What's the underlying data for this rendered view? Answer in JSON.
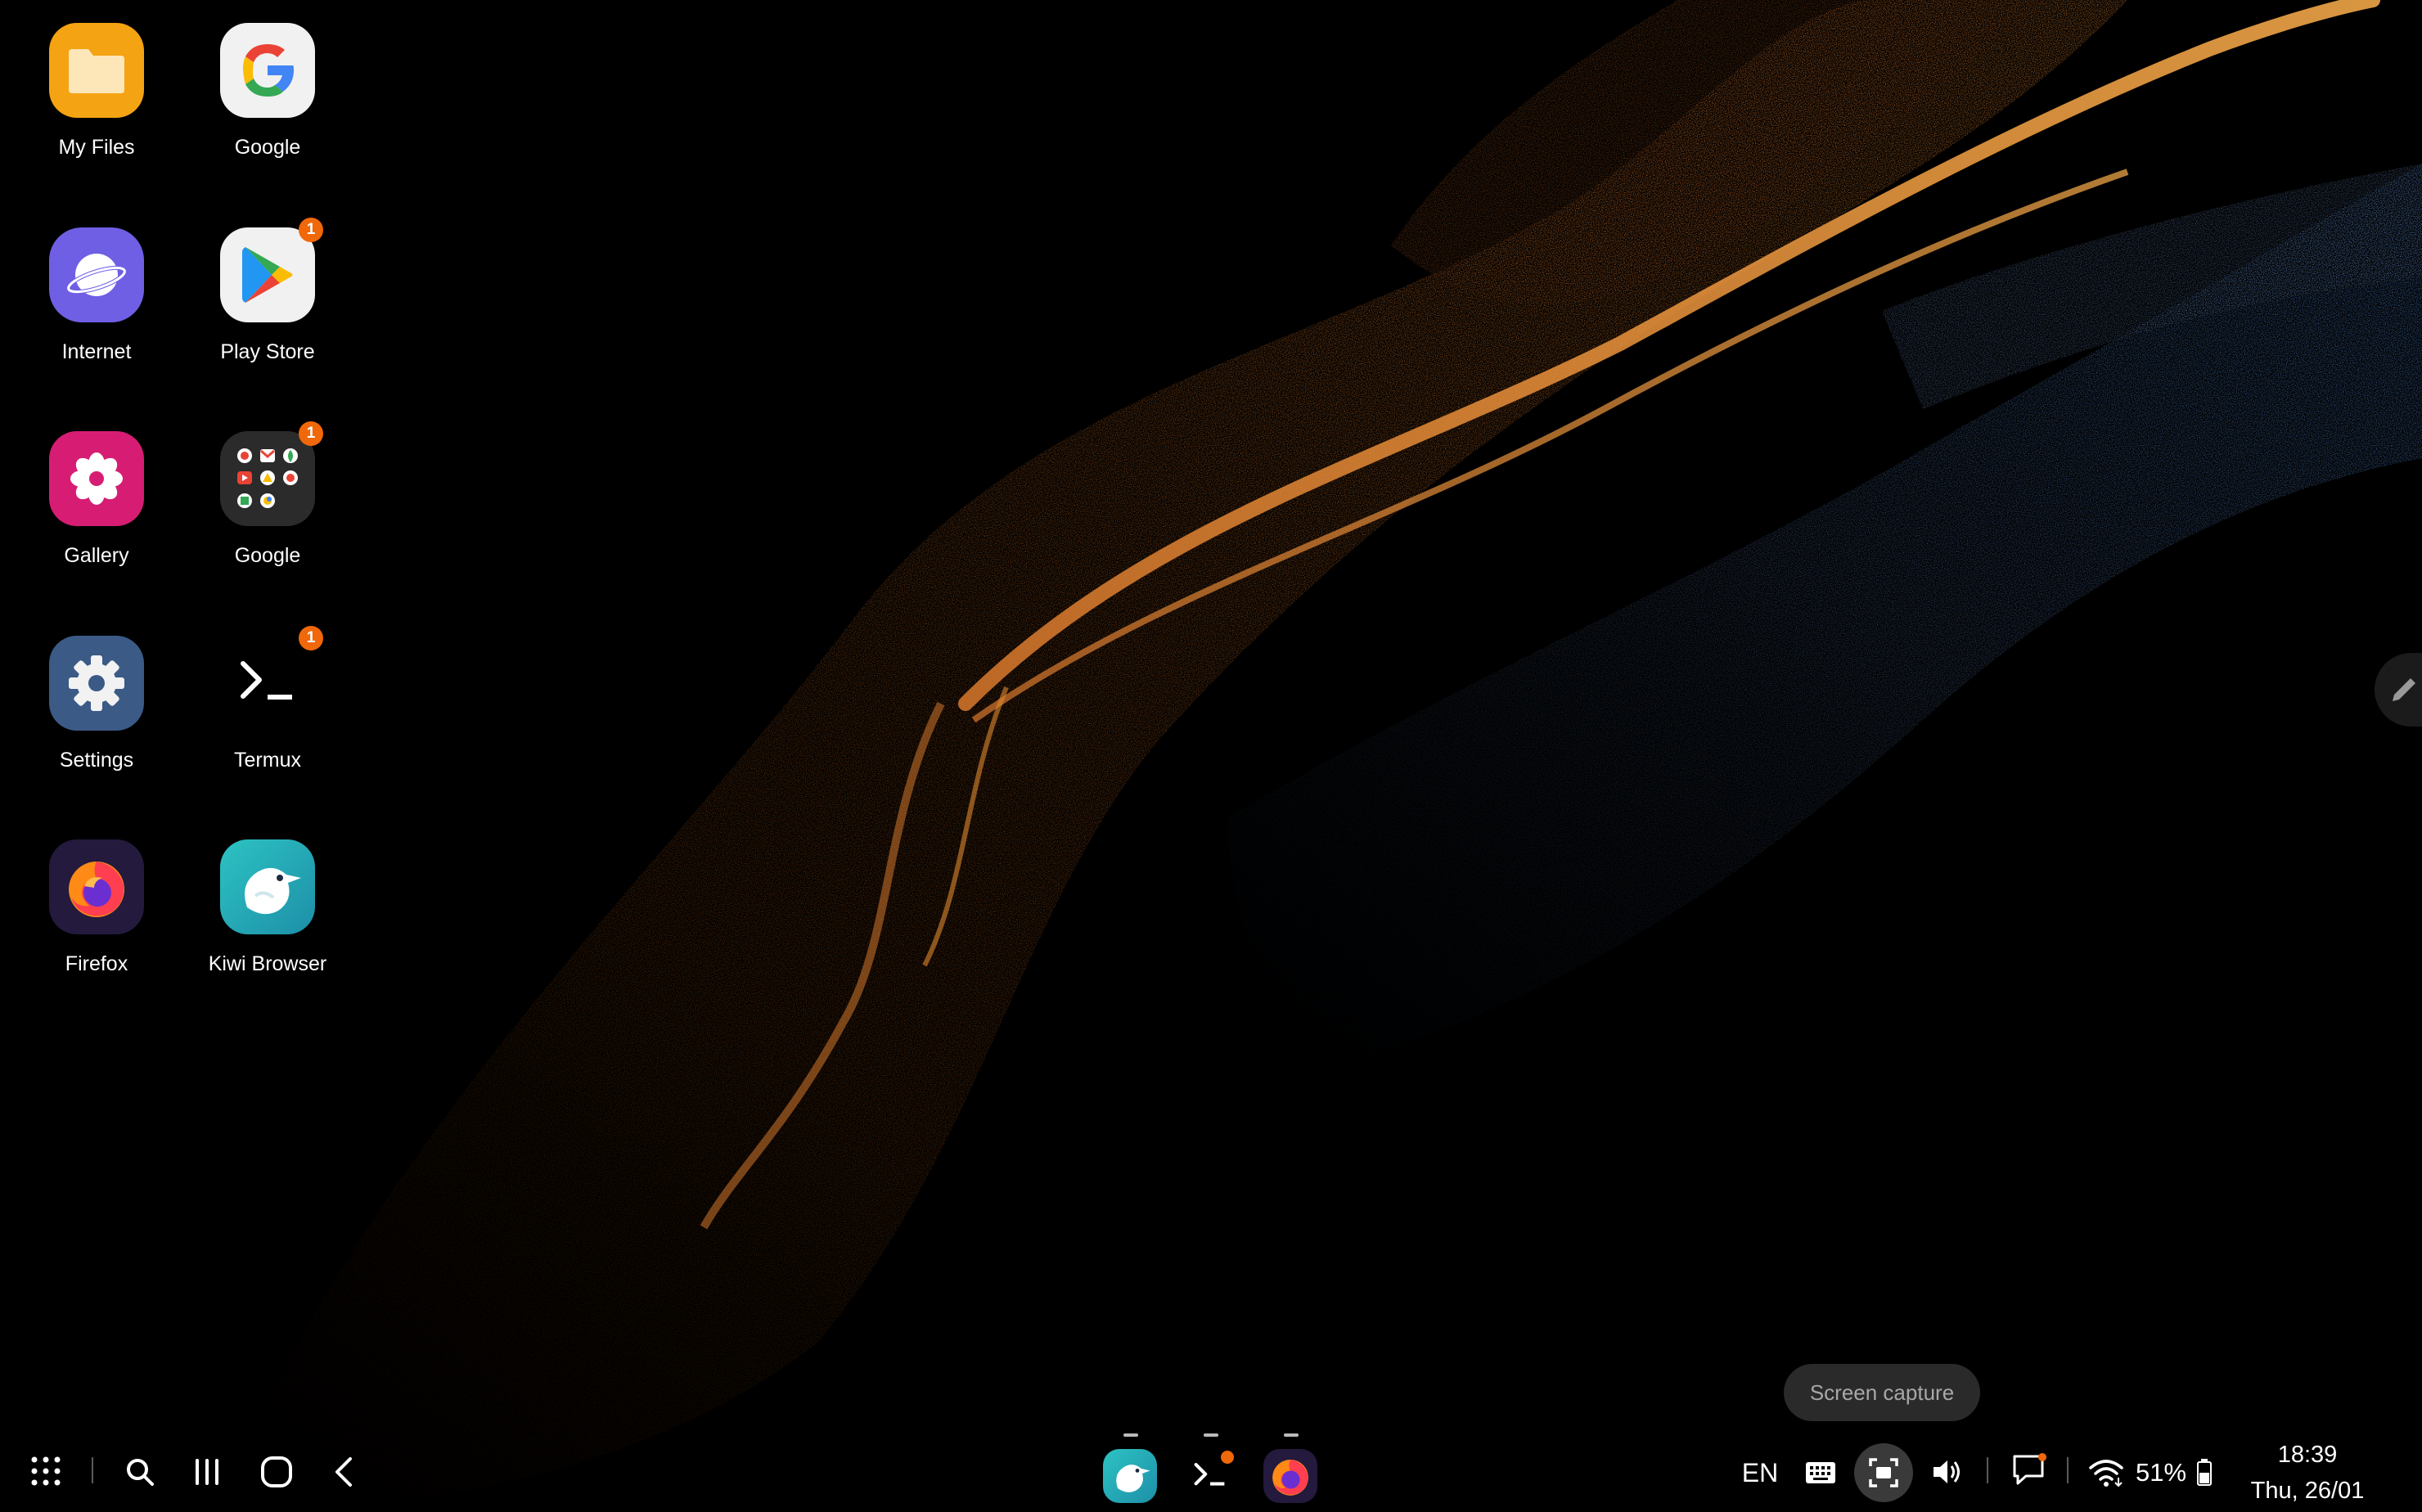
{
  "desktop": {
    "apps": [
      {
        "label": "My Files",
        "icon": "folder-icon"
      },
      {
        "label": "Google",
        "icon": "google-g-icon"
      },
      {
        "label": "Internet",
        "icon": "samsung-internet-icon"
      },
      {
        "label": "Play Store",
        "icon": "play-store-icon",
        "badge": "1"
      },
      {
        "label": "Gallery",
        "icon": "gallery-flower-icon"
      },
      {
        "label": "Google",
        "icon": "google-folder-icon",
        "badge": "1"
      },
      {
        "label": "Settings",
        "icon": "gear-icon"
      },
      {
        "label": "Termux",
        "icon": "terminal-prompt-icon",
        "badge": "1"
      },
      {
        "label": "Firefox",
        "icon": "firefox-icon"
      },
      {
        "label": "Kiwi Browser",
        "icon": "kiwi-bird-icon"
      }
    ]
  },
  "taskbar": {
    "left_buttons": [
      "app-drawer-icon",
      "search-icon",
      "recent-apps-icon",
      "home-icon",
      "back-icon"
    ],
    "pinned_apps": [
      "kiwi-bird-icon",
      "terminal-prompt-icon",
      "firefox-icon"
    ],
    "language": "EN",
    "tooltip": "Screen capture",
    "battery": "51%",
    "time": "18:39",
    "date": "Thu, 26/01"
  },
  "colors": {
    "badge": "#f0680a",
    "wave_orange": "#e07a2a",
    "wave_blue": "#5b8fd6"
  }
}
